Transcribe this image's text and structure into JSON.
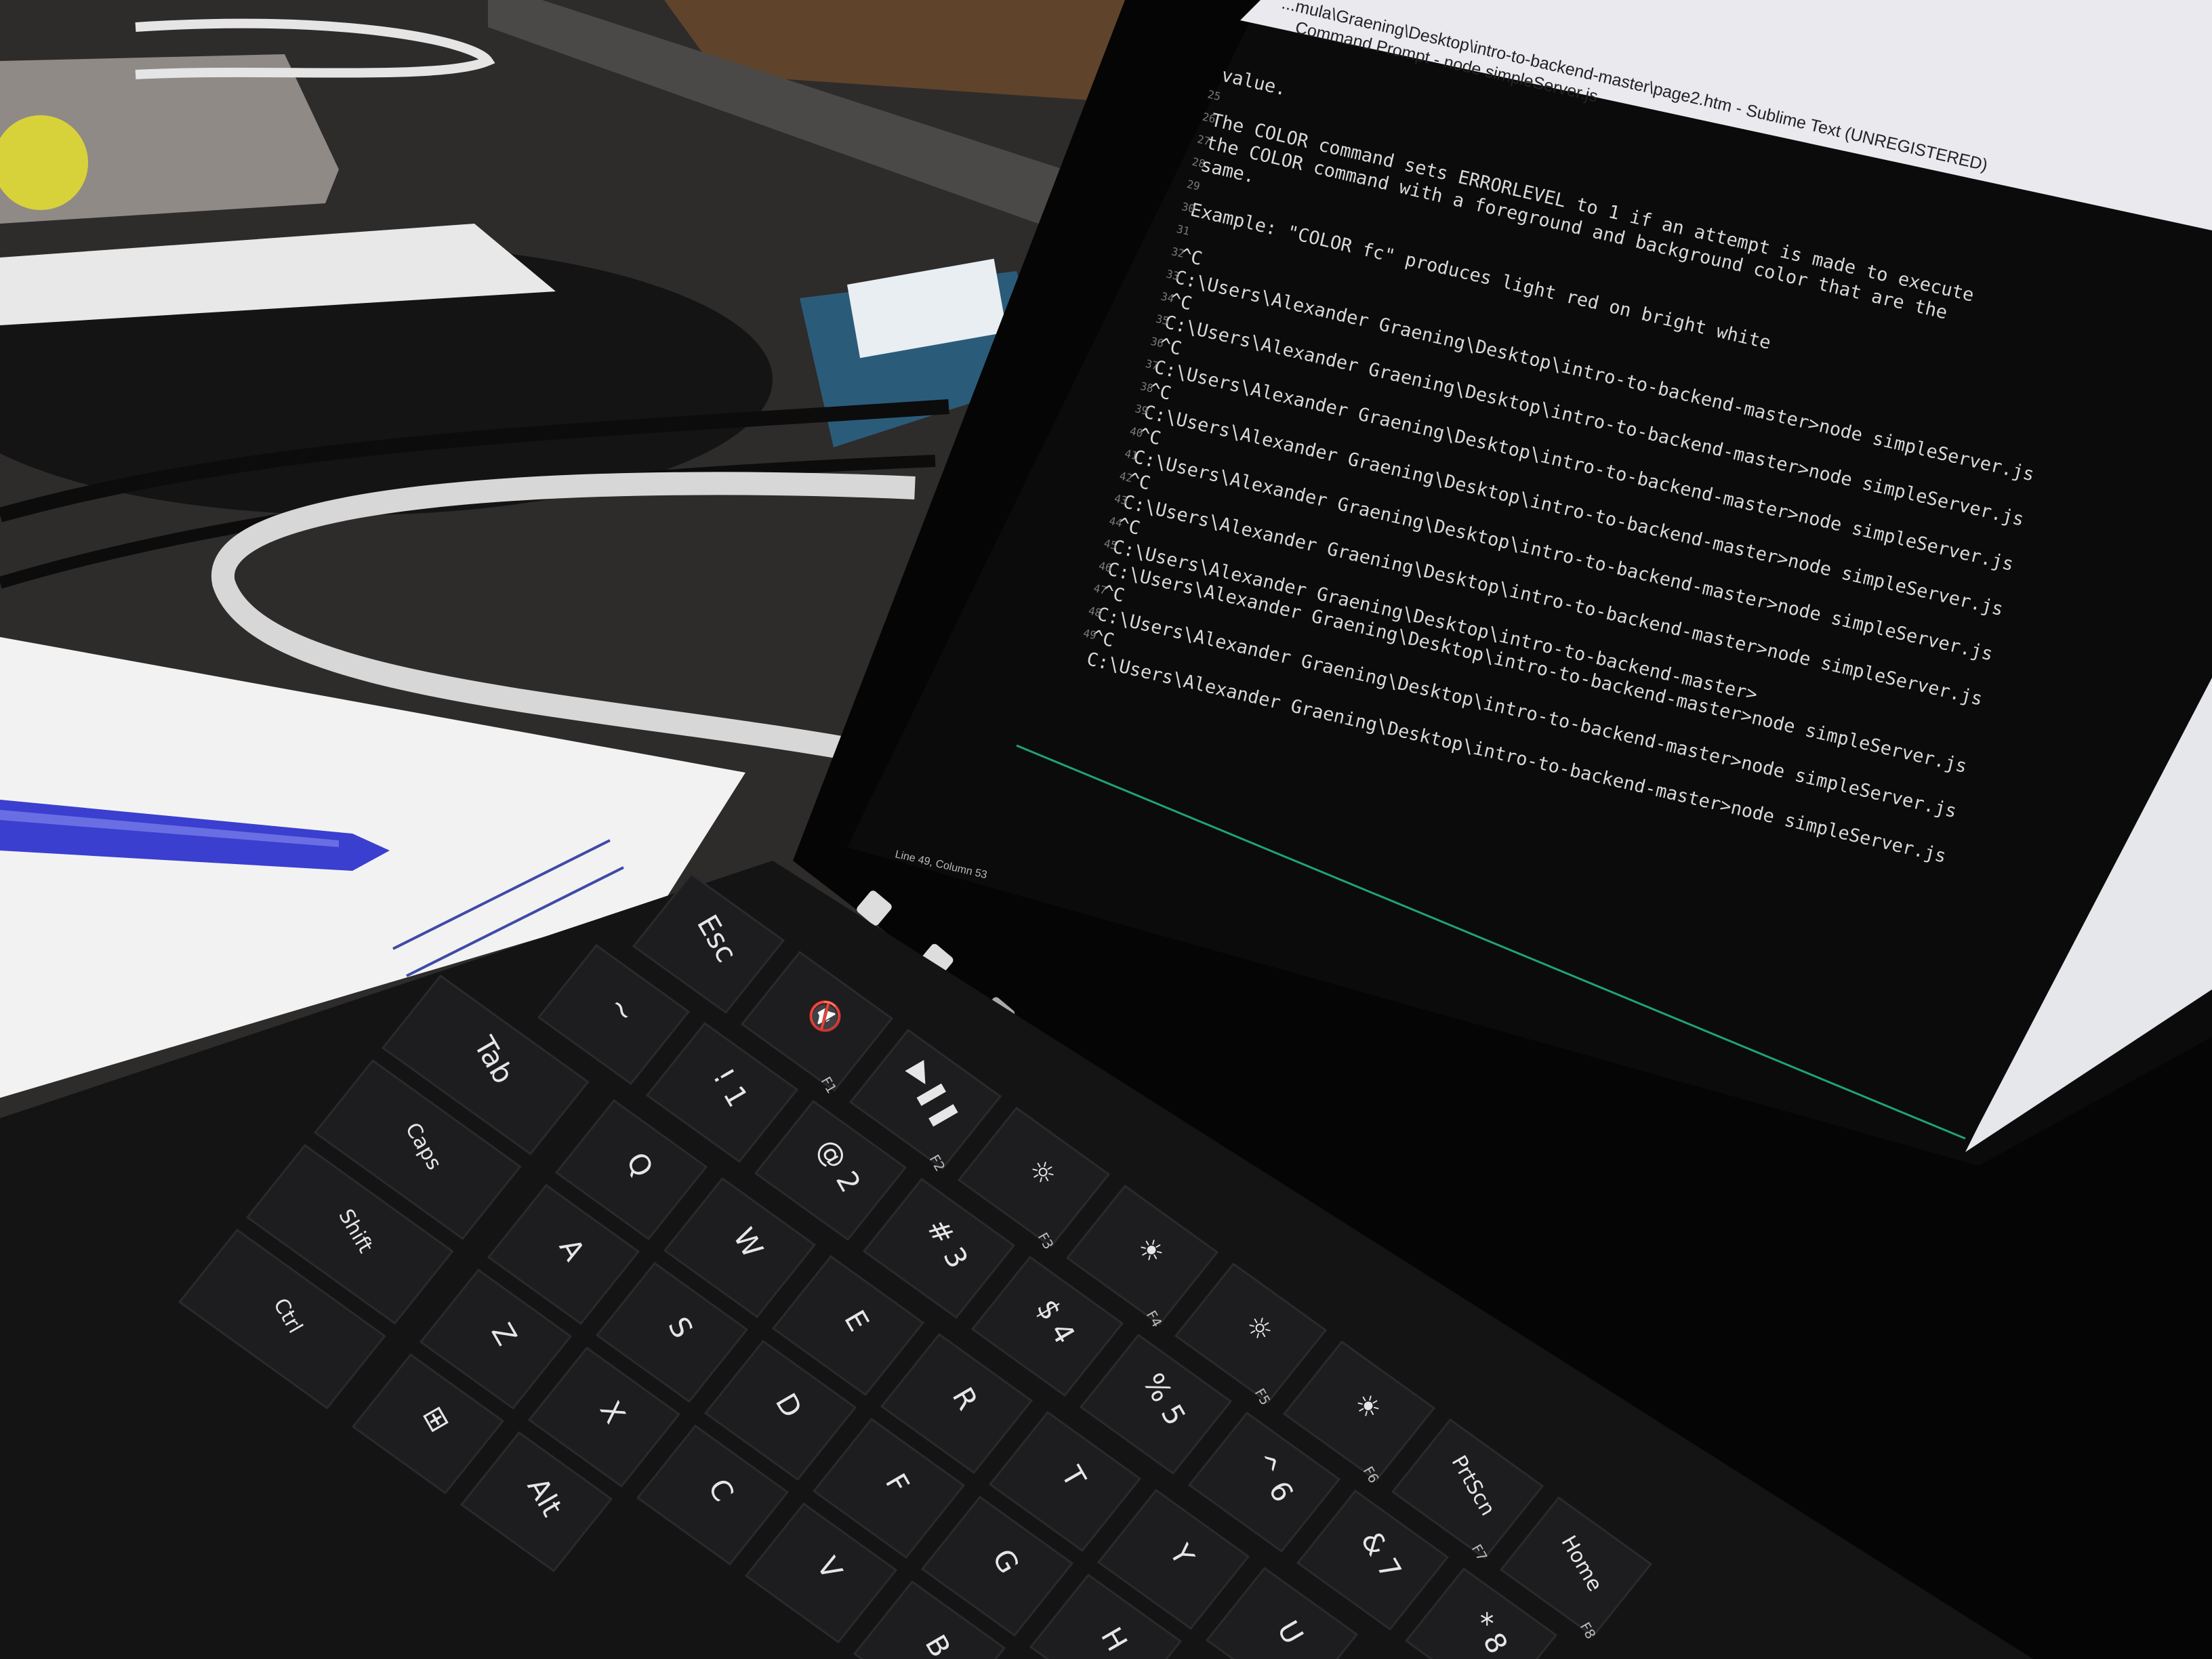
{
  "window": {
    "path_title": "...mula\\Graening\\Desktop\\intro-to-backend-master\\page2.htm - Sublime Text (UNREGISTERED)",
    "cmd_title": "Command Prompt - node simpleServer.js"
  },
  "terminal": {
    "lines": [
      "value.",
      "",
      "The COLOR command sets ERRORLEVEL to 1 if an attempt is made to execute",
      "the COLOR command with a foreground and background color that are the",
      "same.",
      "",
      "Example: \"COLOR fc\" produces light red on bright white",
      "",
      "^C",
      "C:\\Users\\Alexander Graening\\Desktop\\intro-to-backend-master>node simpleServer.js",
      "^C",
      "C:\\Users\\Alexander Graening\\Desktop\\intro-to-backend-master>node simpleServer.js",
      "^C",
      "C:\\Users\\Alexander Graening\\Desktop\\intro-to-backend-master>node simpleServer.js",
      "^C",
      "C:\\Users\\Alexander Graening\\Desktop\\intro-to-backend-master>node simpleServer.js",
      "^C",
      "C:\\Users\\Alexander Graening\\Desktop\\intro-to-backend-master>node simpleServer.js",
      "^C",
      "C:\\Users\\Alexander Graening\\Desktop\\intro-to-backend-master>node simpleServer.js",
      "^C",
      "C:\\Users\\Alexander Graening\\Desktop\\intro-to-backend-master>",
      "C:\\Users\\Alexander Graening\\Desktop\\intro-to-backend-master>node simpleServer.js",
      "^C",
      "C:\\Users\\Alexander Graening\\Desktop\\intro-to-backend-master>node simpleServer.js",
      "^C",
      "C:\\Users\\Alexander Graening\\Desktop\\intro-to-backend-master>node simpleServer.js"
    ],
    "gutter_numbers": [
      "25",
      "26",
      "27",
      "28",
      "29",
      "30",
      "31",
      "32",
      "33",
      "34",
      "35",
      "36",
      "37",
      "38",
      "39",
      "40",
      "41",
      "42",
      "43",
      "44",
      "45",
      "46",
      "47",
      "48",
      "49"
    ]
  },
  "editor_status": "Line 49, Column 53",
  "taskbar": {
    "icons": [
      "windows-start-icon",
      "cortana-icon",
      "task-view-icon",
      "file-explorer-icon",
      "chrome-icon",
      "network-icon",
      "terminal-icon",
      "outlook-icon",
      "firefox-icon",
      "visual-studio-icon",
      "word-icon",
      "box-icon",
      "github-icon",
      "cloud-app-icon",
      "illustrator-icon"
    ]
  },
  "keyboard": {
    "function_row": [
      {
        "name": "esc",
        "label": "Esc",
        "fn": ""
      },
      {
        "name": "f1",
        "label": "🔇",
        "fn": "F1"
      },
      {
        "name": "f2",
        "label": "▶❚❚",
        "fn": "F2"
      },
      {
        "name": "f3",
        "label": "☼",
        "fn": "F3"
      },
      {
        "name": "f4",
        "label": "☀",
        "fn": "F4"
      },
      {
        "name": "f5",
        "label": "☼",
        "fn": "F5"
      },
      {
        "name": "f6",
        "label": "☀",
        "fn": "F6"
      },
      {
        "name": "f7",
        "label": "PrtScn",
        "fn": "F7"
      },
      {
        "name": "f8",
        "label": "Home",
        "fn": "F8"
      }
    ],
    "number_row": [
      {
        "name": "tilde",
        "label": "~"
      },
      {
        "name": "key-1",
        "label": "! 1"
      },
      {
        "name": "key-2",
        "label": "@ 2"
      },
      {
        "name": "key-3",
        "label": "# 3"
      },
      {
        "name": "key-4",
        "label": "$ 4"
      },
      {
        "name": "key-5",
        "label": "% 5"
      },
      {
        "name": "key-6",
        "label": "^ 6"
      },
      {
        "name": "key-7",
        "label": "& 7"
      },
      {
        "name": "key-8",
        "label": "* 8"
      }
    ],
    "letter_rows": [
      [
        "Tab",
        "Q",
        "W",
        "E",
        "R",
        "T",
        "Y",
        "U"
      ],
      [
        "Caps",
        "A",
        "S",
        "D",
        "F",
        "G",
        "H"
      ],
      [
        "Shift",
        "Z",
        "X",
        "C",
        "V",
        "B"
      ],
      [
        "Ctrl",
        "⊞",
        "Alt"
      ]
    ]
  },
  "colors": {
    "screen_bg": "#0b0b0c",
    "terminal_text": "#d9d9d9",
    "key_bg": "#1d1d1f",
    "key_text": "#e6e6e6",
    "pen": "#3a3fd0",
    "tabletop": "#2c2a2a"
  }
}
